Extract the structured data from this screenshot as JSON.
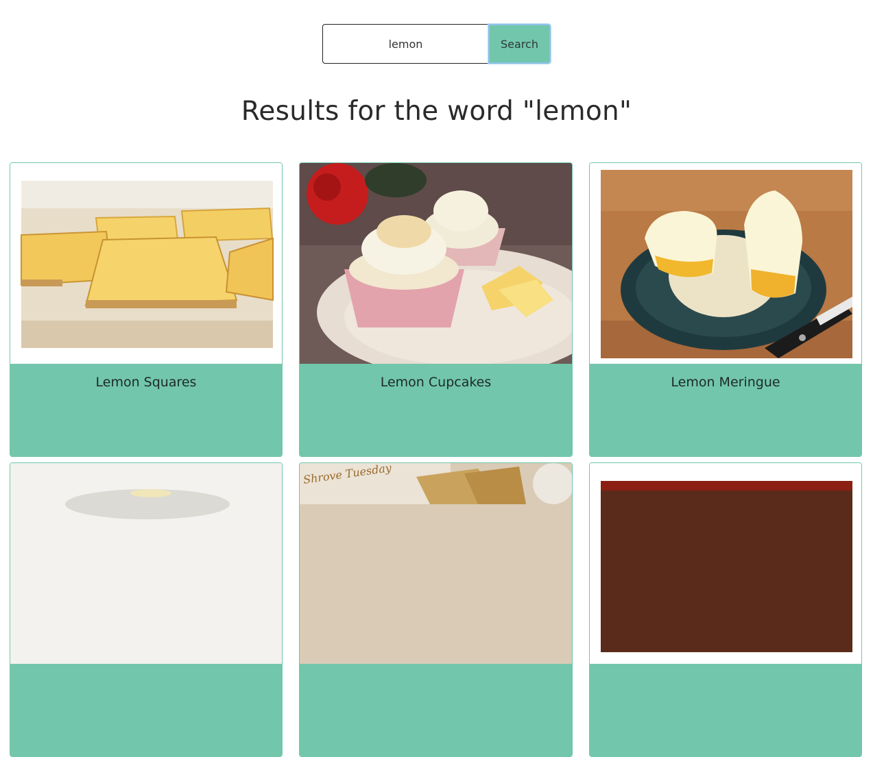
{
  "search": {
    "value": "lemon",
    "button_label": "Search"
  },
  "results": {
    "heading": "Results for the word \"lemon\""
  },
  "cards": [
    {
      "title": "Lemon Squares",
      "image": "lemon-squares-photo"
    },
    {
      "title": "Lemon Cupcakes",
      "image": "lemon-cupcakes-photo"
    },
    {
      "title": "Lemon Meringue",
      "image": "lemon-meringue-photo"
    },
    {
      "title": "",
      "image": "lemon-tart-photo"
    },
    {
      "title": "",
      "image": "shrove-tuesday-pancakes-photo",
      "image_text": "Shrove Tuesday"
    },
    {
      "title": "",
      "image": "lemon-dish-photo"
    }
  ],
  "colors": {
    "accent": "#72c6ab",
    "focus_ring": "#8ec3ea"
  }
}
